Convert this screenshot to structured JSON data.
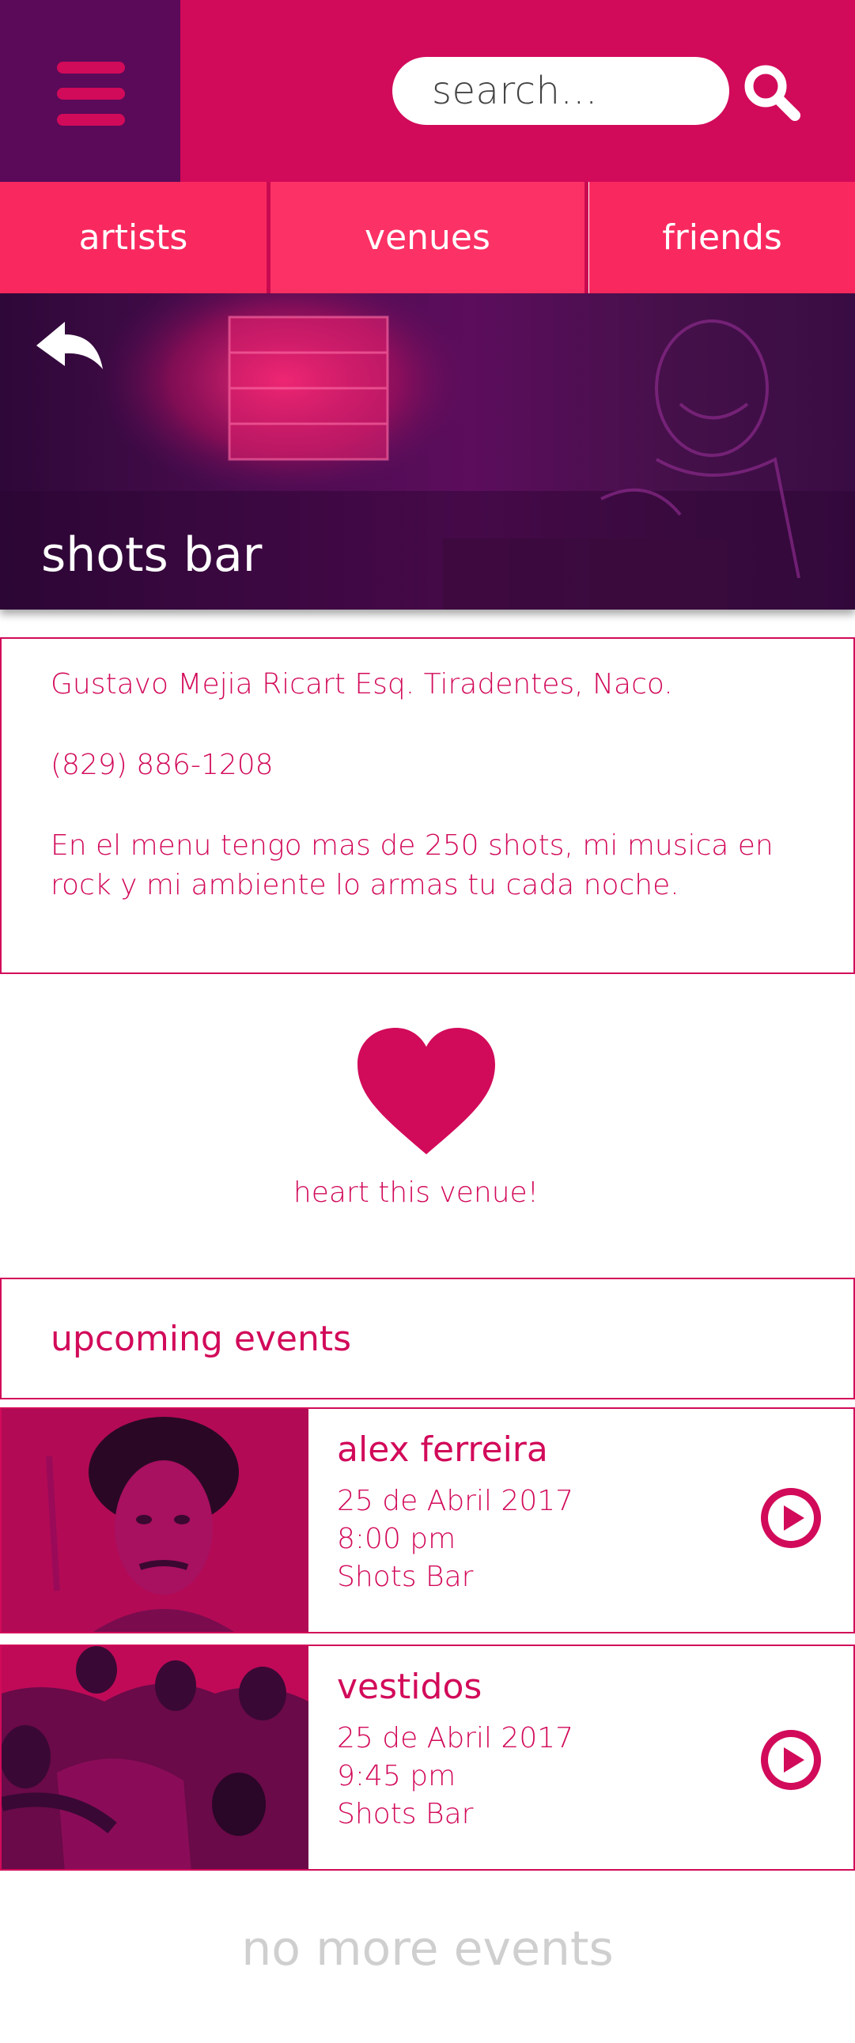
{
  "header": {
    "search_placeholder": "search..."
  },
  "tabs": [
    {
      "label": "artists"
    },
    {
      "label": "venues"
    },
    {
      "label": "friends"
    }
  ],
  "venue": {
    "name": "shots bar",
    "address": "Gustavo Mejia Ricart Esq. Tiradentes, Naco.",
    "phone": "(829) 886-1208",
    "description_line1": "En el menu tengo mas de 250 shots, mi musica en",
    "description_line2": "rock y mi ambiente lo armas tu cada noche."
  },
  "heart_label": "heart this venue!",
  "upcoming_title": "upcoming events",
  "events": [
    {
      "name": "alex ferreira",
      "date": "25 de Abril 2017",
      "time": "8:00 pm",
      "venue": "Shots Bar"
    },
    {
      "name": "vestidos",
      "date": "25 de Abril 2017",
      "time": "9:45 pm",
      "venue": "Shots Bar"
    }
  ],
  "footer_text": "no more events",
  "colors": {
    "brand": "#d20a5a",
    "dark_purple": "#5a0a58",
    "tab": "#f9295f",
    "muted": "#cfcfcf"
  },
  "icons": {
    "menu": "hamburger-icon",
    "search": "magnifier-icon",
    "back": "back-arrow-icon",
    "heart": "heart-icon",
    "play": "play-icon"
  }
}
